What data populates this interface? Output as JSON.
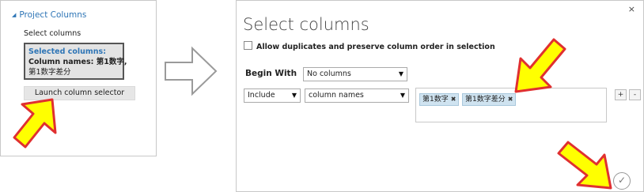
{
  "left_panel": {
    "header": "Project Columns",
    "select_label": "Select columns",
    "selected_title": "Selected columns:",
    "column_names_label": "Column names: 第1数字,",
    "column_names_cont": "第1数字差分",
    "launch_button": "Launch column selector"
  },
  "dialog": {
    "title": "Select columns",
    "close": "×",
    "allow_duplicates_label": "Allow duplicates and preserve column order in selection",
    "begin_with_label": "Begin With",
    "begin_with_value": "No columns",
    "rule_include": "Include",
    "rule_type": "column names",
    "tags": [
      "第1数字",
      "第1数字差分"
    ],
    "tag_remove": "✖",
    "add_button": "+",
    "remove_button": "-",
    "ok_icon": "✓"
  },
  "colors": {
    "accent_blue": "#2e75b6",
    "arrow_yellow": "#ffff00",
    "arrow_red": "#e03030",
    "tag_bg": "#cfe3f0"
  }
}
